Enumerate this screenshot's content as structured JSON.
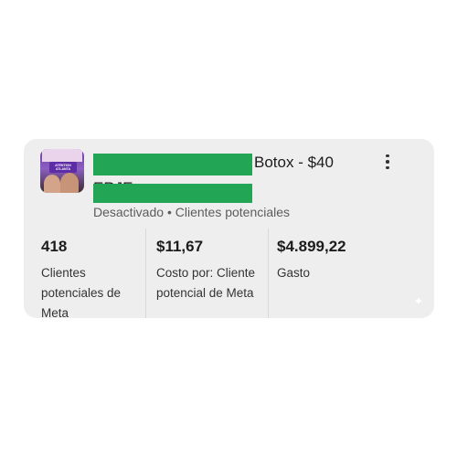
{
  "campaign": {
    "title_line_1": "Botox - $40",
    "title_line_2": "ERJE",
    "status": "Desactivado",
    "separator": "•",
    "result_type": "Clientes potenciales",
    "thumbnail_text": "ATENTION ATLANTA"
  },
  "metrics": [
    {
      "value": "418",
      "label": "Clientes potenciales de Meta"
    },
    {
      "value": "$11,67",
      "label": "Costo por: Cliente potencial de Meta"
    },
    {
      "value": "$4.899,22",
      "label": "Gasto"
    }
  ],
  "icons": {
    "menu": "more-vertical-icon",
    "sparkle": "sparkle-icon"
  },
  "colors": {
    "card_background": "#eeeeef",
    "redaction": "#22a656"
  }
}
